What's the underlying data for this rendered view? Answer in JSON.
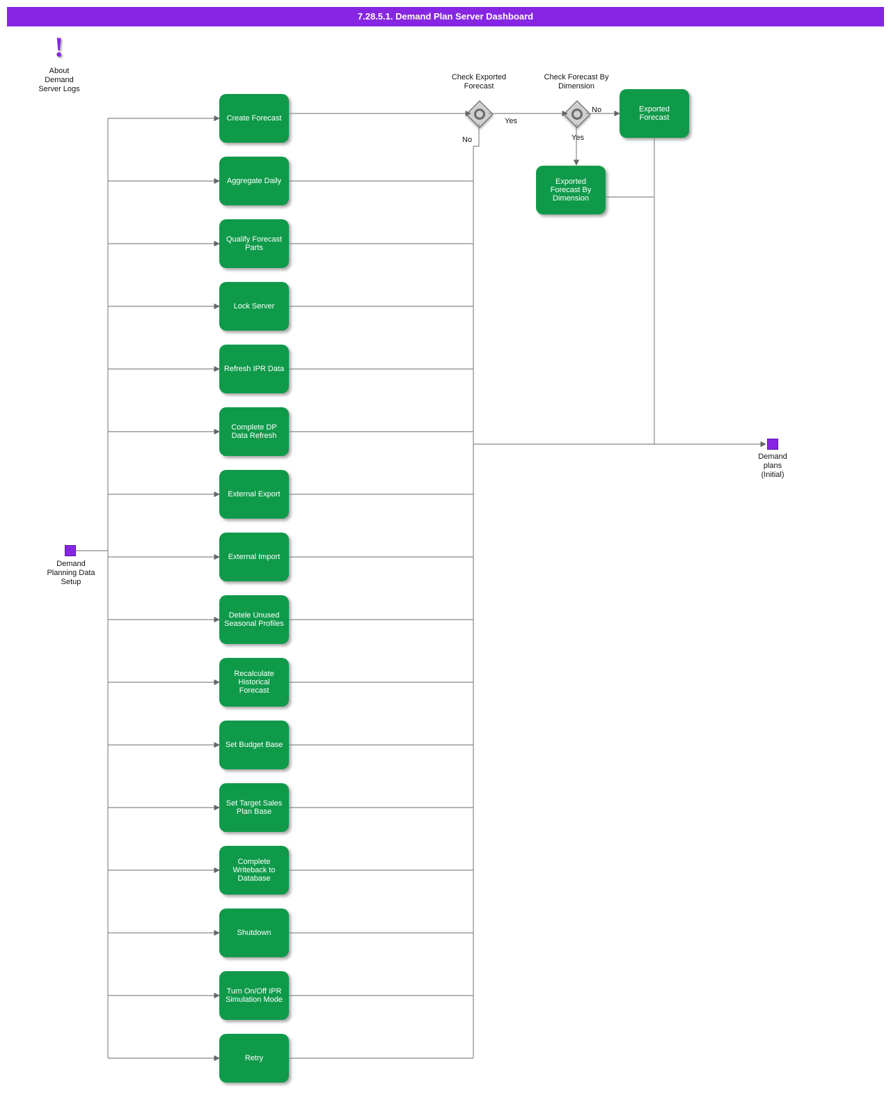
{
  "header": {
    "title": "7.28.5.1. Demand Plan Server Dashboard"
  },
  "about": {
    "label": "About Demand Server Logs"
  },
  "start": {
    "label": "Demand Planning Data Setup"
  },
  "end": {
    "label": "Demand plans (Initial)"
  },
  "activities": {
    "a1": {
      "label": "Create Forecast"
    },
    "a2": {
      "label": "Aggregate Daily"
    },
    "a3": {
      "label": "Qualify Forecast Parts"
    },
    "a4": {
      "label": "Lock Server"
    },
    "a5": {
      "label": "Refresh IPR Data"
    },
    "a6": {
      "label": "Complete DP Data Refresh"
    },
    "a7": {
      "label": "External Export"
    },
    "a8": {
      "label": "External Import"
    },
    "a9": {
      "label": "Detele Unused Seasonal Profiles"
    },
    "a10": {
      "label": "Recalculate Historical Forecast"
    },
    "a11": {
      "label": "Set Budget Base"
    },
    "a12": {
      "label": "Set Target Sales Plan Base"
    },
    "a13": {
      "label": "Complete Writeback to Database"
    },
    "a14": {
      "label": "Shutdown"
    },
    "a15": {
      "label": "Turn On/Off IPR Simulation Mode"
    },
    "a16": {
      "label": "Retry"
    },
    "e1": {
      "label": "Exported Forecast"
    },
    "e2": {
      "label": "Exported Forecast By Dimension"
    }
  },
  "gateways": {
    "g1": {
      "label": "Check Exported Forecast"
    },
    "g2": {
      "label": "Check Forecast By Dimension"
    }
  },
  "edge_labels": {
    "g1_yes": "Yes",
    "g1_no": "No",
    "g2_yes": "Yes",
    "g2_no": "No"
  },
  "colors": {
    "brand_purple": "#8626e2",
    "activity_green": "#0f9a4a"
  }
}
